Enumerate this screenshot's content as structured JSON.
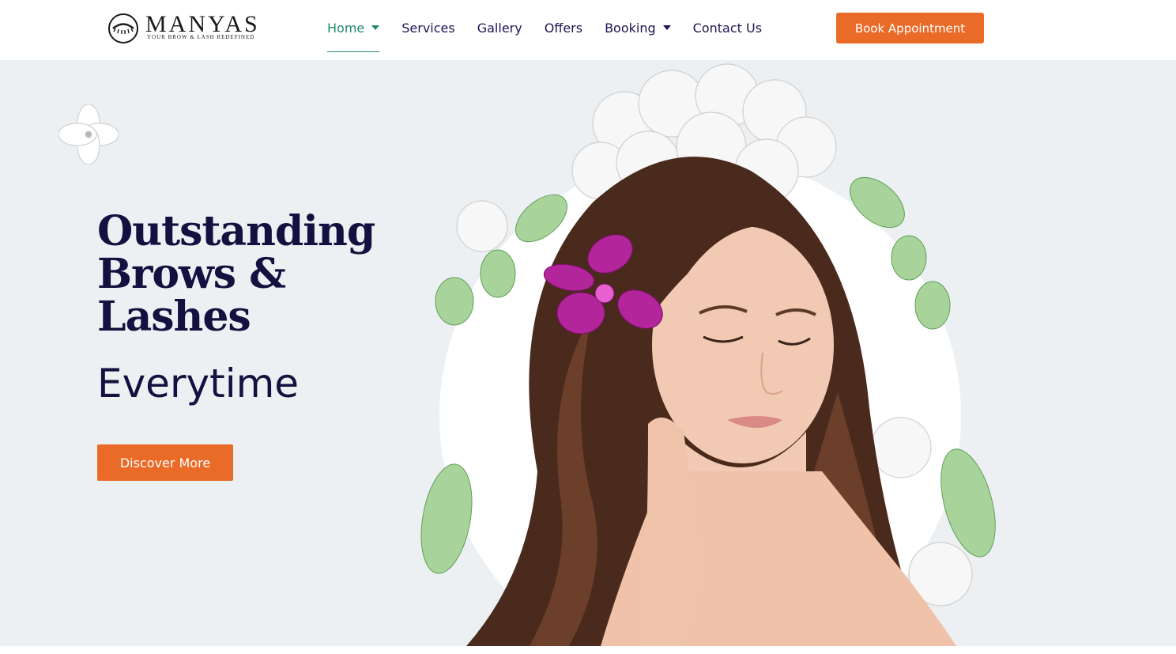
{
  "brand": {
    "name": "MANYAS",
    "tagline": "YOUR BROW & LASH REDEFINED"
  },
  "nav": {
    "items": [
      {
        "label": "Home",
        "active": true,
        "has_dropdown": true
      },
      {
        "label": "Services",
        "active": false,
        "has_dropdown": false
      },
      {
        "label": "Gallery",
        "active": false,
        "has_dropdown": false
      },
      {
        "label": "Offers",
        "active": false,
        "has_dropdown": false
      },
      {
        "label": "Booking",
        "active": false,
        "has_dropdown": true
      },
      {
        "label": "Contact Us",
        "active": false,
        "has_dropdown": false
      }
    ],
    "cta_label": "Book Appointment"
  },
  "hero": {
    "headline_lines": [
      "Outstanding",
      "Brows &",
      "Lashes"
    ],
    "subline": "Everytime",
    "button_label": "Discover More"
  },
  "colors": {
    "navy": "#15103f",
    "accent_orange": "#e96b27",
    "active_green": "#1f8a6f",
    "hero_bg": "#edf0f3"
  },
  "icons": [
    "eye-lash-logo-icon",
    "chevron-down-icon",
    "flower-icon"
  ]
}
